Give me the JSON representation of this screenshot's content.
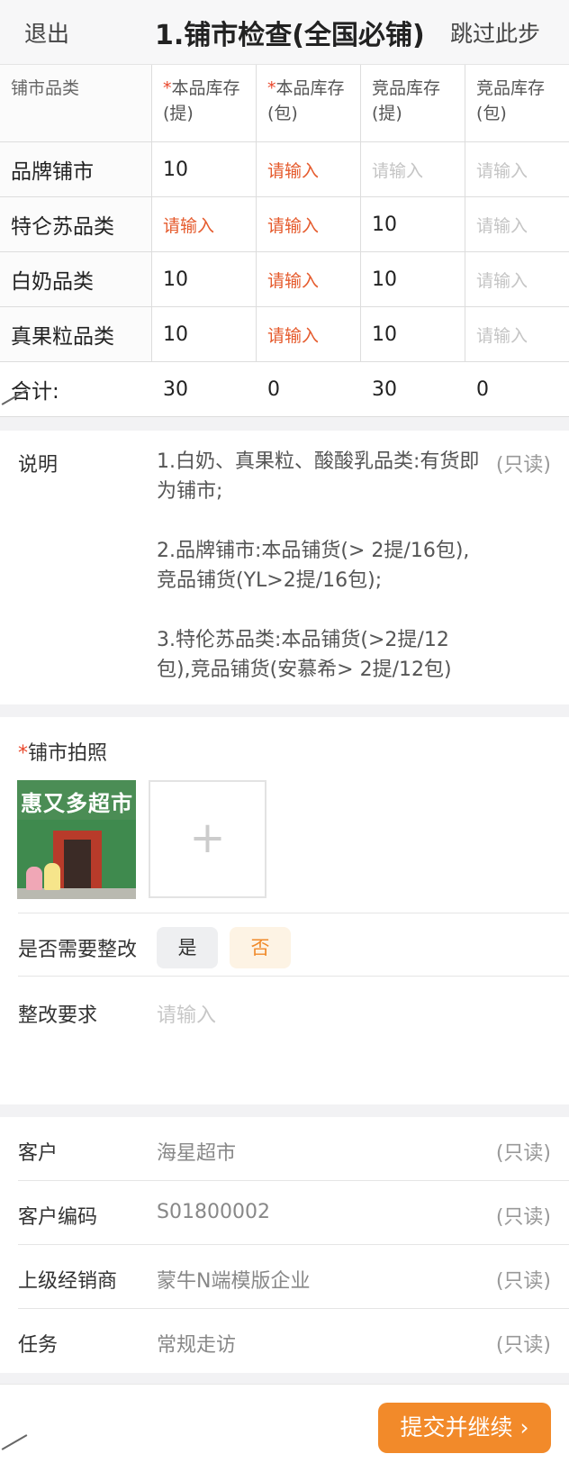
{
  "header": {
    "back_label": "退出",
    "title": "1.铺市检查(全国必铺)",
    "skip_label": "跳过此步"
  },
  "grid": {
    "columns": [
      {
        "label": "铺市品类",
        "required": false
      },
      {
        "label": "本品库存(提)",
        "required": true
      },
      {
        "label": "本品库存(包)",
        "required": true
      },
      {
        "label": "竞品库存(提)",
        "required": false
      },
      {
        "label": "竞品库存(包)",
        "required": false
      }
    ],
    "rows": [
      {
        "name": "品牌铺市",
        "cells": [
          {
            "value": "10",
            "state": "filled"
          },
          {
            "value": "请输入",
            "state": "required-empty"
          },
          {
            "value": "请输入",
            "state": "empty"
          },
          {
            "value": "请输入",
            "state": "empty"
          }
        ]
      },
      {
        "name": "特仑苏品类",
        "cells": [
          {
            "value": "请输入",
            "state": "required-empty"
          },
          {
            "value": "请输入",
            "state": "required-empty"
          },
          {
            "value": "10",
            "state": "filled"
          },
          {
            "value": "请输入",
            "state": "empty"
          }
        ]
      },
      {
        "name": "白奶品类",
        "cells": [
          {
            "value": "10",
            "state": "filled"
          },
          {
            "value": "请输入",
            "state": "required-empty"
          },
          {
            "value": "10",
            "state": "filled"
          },
          {
            "value": "请输入",
            "state": "empty"
          }
        ]
      },
      {
        "name": "真果粒品类",
        "cells": [
          {
            "value": "10",
            "state": "filled"
          },
          {
            "value": "请输入",
            "state": "required-empty"
          },
          {
            "value": "10",
            "state": "filled"
          },
          {
            "value": "请输入",
            "state": "empty"
          }
        ]
      }
    ],
    "total": {
      "label": "合计:",
      "values": [
        "30",
        "0",
        "30",
        "0"
      ]
    }
  },
  "description": {
    "label": "说明",
    "readonly": "(只读)",
    "paragraphs": [
      "1.白奶、真果粒、酸酸乳品类:有货即为铺市;",
      "2.品牌铺市:本品铺货(> 2提/16包),竞品铺货(YL>2提/16包);",
      "3.特伦苏品类:本品铺货(>2提/12包),竞品铺货(安慕希> 2提/12包)"
    ]
  },
  "photo": {
    "label": "铺市拍照",
    "required": true,
    "thumbnail_sign": "惠又多超市",
    "add_icon": "plus-icon"
  },
  "rectify": {
    "label": "是否需要整改",
    "options": [
      "是",
      "否"
    ],
    "selected": "否"
  },
  "requirement": {
    "label": "整改要求",
    "placeholder": "请输入"
  },
  "info": [
    {
      "label": "客户",
      "value": "海星超市",
      "readonly": "(只读)"
    },
    {
      "label": "客户编码",
      "value": "S01800002",
      "readonly": "(只读)"
    },
    {
      "label": "上级经销商",
      "value": "蒙牛N端模版企业",
      "readonly": "(只读)"
    },
    {
      "label": "任务",
      "value": "常规走访",
      "readonly": "(只读)"
    }
  ],
  "footer": {
    "submit_label": "提交并继续",
    "submit_icon": "chevron-right-icon"
  },
  "colors": {
    "accent": "#f28a2a",
    "required": "#e9472b",
    "selected_bg": "#fdf3e4"
  }
}
